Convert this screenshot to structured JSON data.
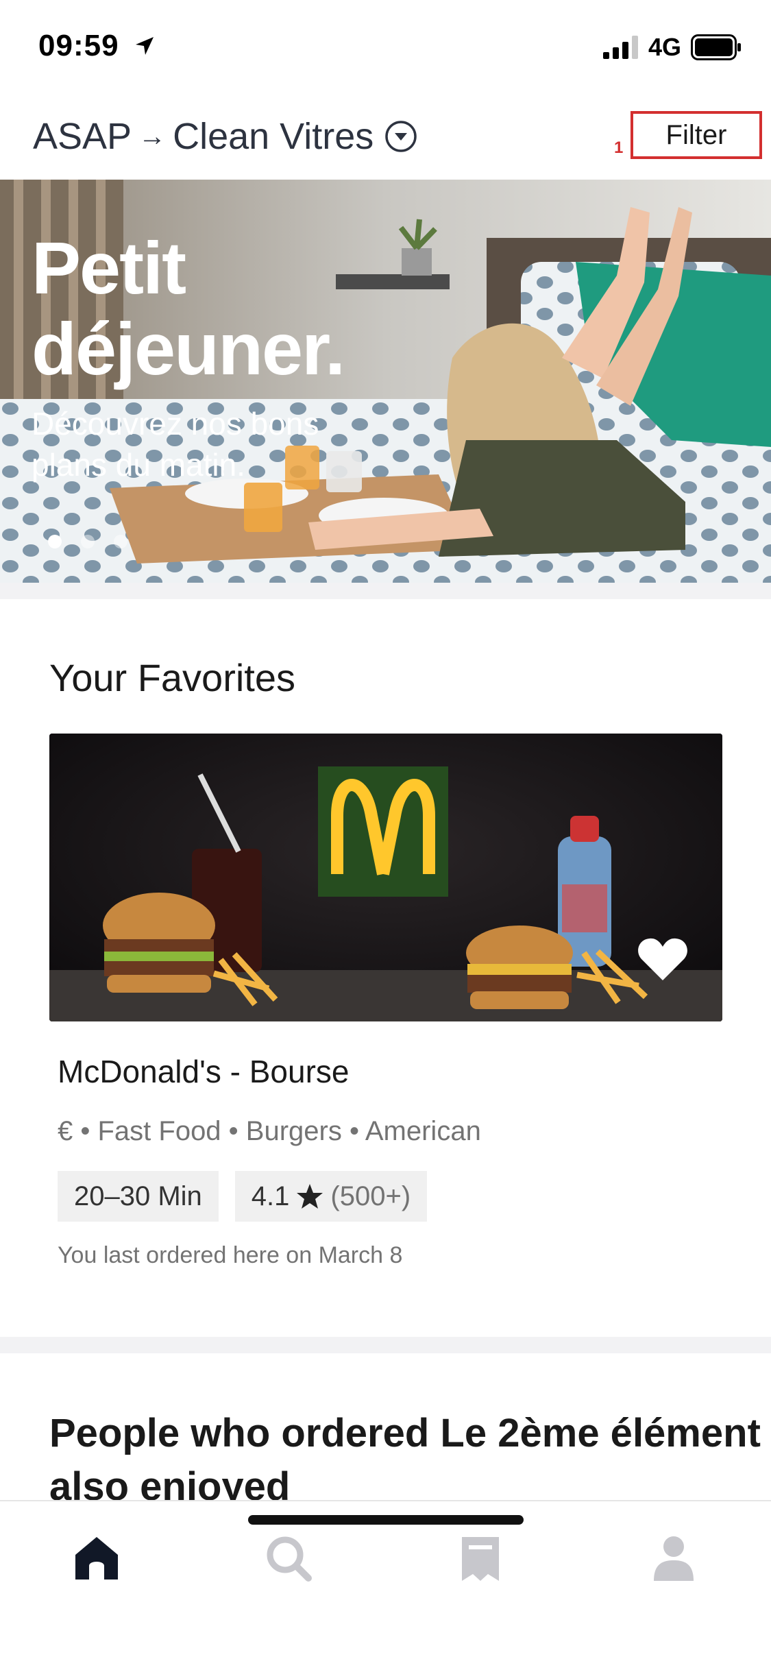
{
  "status_bar": {
    "time": "09:59",
    "network": "4G"
  },
  "header": {
    "time_option": "ASAP",
    "arrow": "→",
    "place": "Clean Vitres",
    "marker": "1",
    "filter_label": "Filter"
  },
  "hero": {
    "title": "Petit\ndéjeuner.",
    "subtitle": "Découvrez nos bons plans du matin.",
    "slide_count": 3,
    "active_slide": 1
  },
  "favorites": {
    "title": "Your Favorites",
    "restaurant": {
      "name": "McDonald's - Bourse",
      "meta": "€ • Fast Food • Burgers • American",
      "eta": "20–30 Min",
      "rating": "4.1",
      "rating_count": "(500+)",
      "last_ordered": "You last ordered here on March 8",
      "favorited": true
    }
  },
  "people": {
    "title": "People who ordered Le 2ème élément also enjoyed"
  },
  "bottom_nav": {
    "items": [
      "home",
      "search",
      "orders",
      "account"
    ],
    "active": "home"
  },
  "colors": {
    "highlight": "#d32f2f",
    "nav_active": "#111827",
    "nav_inactive": "#c7c7cc",
    "mcd_green": "#264d1f",
    "mcd_yellow": "#ffc72c"
  }
}
